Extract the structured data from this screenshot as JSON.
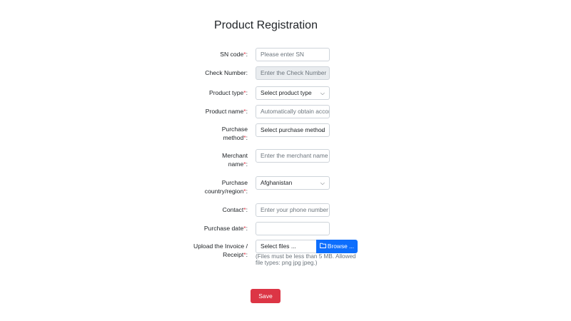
{
  "page": {
    "title": "Product Registration"
  },
  "form": {
    "sn": {
      "label": "SN code",
      "required_mark": "*",
      "colon": ":",
      "placeholder": "Please enter SN"
    },
    "check": {
      "label": "Check Number:",
      "placeholder": "Enter the Check Number"
    },
    "product_type": {
      "label": "Product type",
      "required_mark": "*",
      "colon": ":",
      "value": "Select product type"
    },
    "product_name": {
      "label": "Product name",
      "required_mark": "*",
      "colon": ":",
      "placeholder": "Automatically obtain according to SN"
    },
    "purchase_method": {
      "label_line1": "Purchase",
      "label_line2": "method",
      "required_mark": "*",
      "colon": ":",
      "value": "Select purchase method"
    },
    "merchant": {
      "label_line1": "Merchant",
      "label_line2": "name",
      "required_mark": "*",
      "colon": ":",
      "placeholder": "Enter the merchant name"
    },
    "country": {
      "label_line1": "Purchase",
      "label_line2": "country/region",
      "required_mark": "*",
      "colon": ":",
      "value": "Afghanistan"
    },
    "contact": {
      "label": "Contact",
      "required_mark": "*",
      "colon": ":",
      "placeholder": "Enter your phone number"
    },
    "date": {
      "label": "Purchase date",
      "required_mark": "*",
      "colon": ":",
      "value": ""
    },
    "invoice": {
      "label_line1": "Upload the Invoice /",
      "label_line2": "Receipt",
      "required_mark": "*",
      "colon": ":",
      "file_placeholder": "Select files ...",
      "browse_label": "Browse ...",
      "hint_line1": "(Files must be less than 5 MB. Allowed",
      "hint_line2": "file types: png jpg jpeg.)"
    }
  },
  "actions": {
    "save_label": "Save"
  },
  "colors": {
    "required": "#dc3545",
    "browse": "#0d6efd",
    "save": "#dc3545",
    "disabled_bg": "#e9ecef"
  },
  "icons": {
    "select": "chevron-down-icon",
    "browse": "folder-icon"
  }
}
